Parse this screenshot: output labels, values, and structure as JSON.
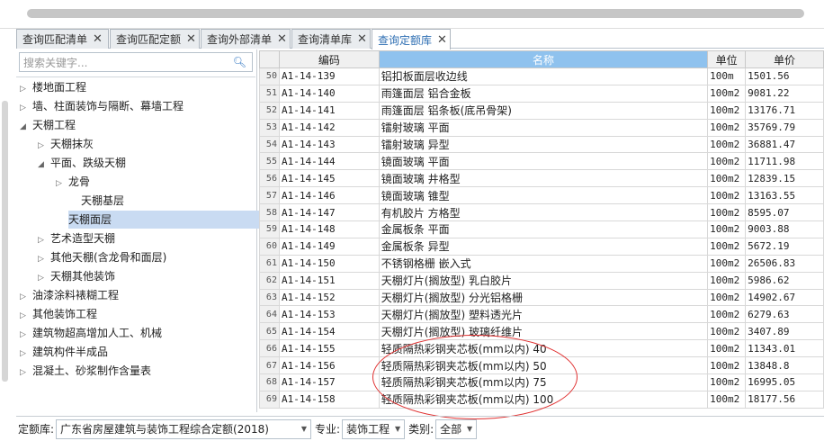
{
  "tabs": [
    {
      "label": "查询匹配清单",
      "close": "✕"
    },
    {
      "label": "查询匹配定额",
      "close": "✕"
    },
    {
      "label": "查询外部清单",
      "close": "✕"
    },
    {
      "label": "查询清单库",
      "close": "✕"
    },
    {
      "label": "查询定额库",
      "close": "✕"
    }
  ],
  "search": {
    "placeholder": "搜索关键字..."
  },
  "tree": [
    {
      "label": "楼地面工程",
      "arrow": "▷",
      "level": 0
    },
    {
      "label": "墙、柱面装饰与隔断、幕墙工程",
      "arrow": "▷",
      "level": 0
    },
    {
      "label": "天棚工程",
      "arrow": "◢",
      "level": 0
    },
    {
      "label": "天棚抹灰",
      "arrow": "▷",
      "level": 1
    },
    {
      "label": "平面、跌级天棚",
      "arrow": "◢",
      "level": 1
    },
    {
      "label": "龙骨",
      "arrow": "▷",
      "level": 2
    },
    {
      "label": "天棚基层",
      "arrow": "",
      "level": 2
    },
    {
      "label": "天棚面层",
      "arrow": "",
      "level": 2,
      "selected": true
    },
    {
      "label": "艺术造型天棚",
      "arrow": "▷",
      "level": 1
    },
    {
      "label": "其他天棚(含龙骨和面层)",
      "arrow": "▷",
      "level": 1
    },
    {
      "label": "天棚其他装饰",
      "arrow": "▷",
      "level": 1
    },
    {
      "label": "油漆涂料裱糊工程",
      "arrow": "▷",
      "level": 0
    },
    {
      "label": "其他装饰工程",
      "arrow": "▷",
      "level": 0
    },
    {
      "label": "建筑物超高增加人工、机械",
      "arrow": "▷",
      "level": 0
    },
    {
      "label": "建筑构件半成品",
      "arrow": "▷",
      "level": 0
    },
    {
      "label": "混凝土、砂浆制作含量表",
      "arrow": "▷",
      "level": 0
    }
  ],
  "columns": {
    "code": "编码",
    "name": "名称",
    "unit": "单位",
    "price": "单价"
  },
  "rows": [
    {
      "n": "50",
      "code": "A1-14-139",
      "name": "铝扣板面层收边线",
      "unit": "100m",
      "price": "1501.56"
    },
    {
      "n": "51",
      "code": "A1-14-140",
      "name": "雨篷面层 铝合金板",
      "unit": "100m2",
      "price": "9081.22"
    },
    {
      "n": "52",
      "code": "A1-14-141",
      "name": "雨篷面层 铝条板(底吊骨架)",
      "unit": "100m2",
      "price": "13176.71"
    },
    {
      "n": "53",
      "code": "A1-14-142",
      "name": "镭射玻璃 平面",
      "unit": "100m2",
      "price": "35769.79"
    },
    {
      "n": "54",
      "code": "A1-14-143",
      "name": "镭射玻璃 异型",
      "unit": "100m2",
      "price": "36881.47"
    },
    {
      "n": "55",
      "code": "A1-14-144",
      "name": "镜面玻璃 平面",
      "unit": "100m2",
      "price": "11711.98"
    },
    {
      "n": "56",
      "code": "A1-14-145",
      "name": "镜面玻璃 井格型",
      "unit": "100m2",
      "price": "12839.15"
    },
    {
      "n": "57",
      "code": "A1-14-146",
      "name": "镜面玻璃 锥型",
      "unit": "100m2",
      "price": "13163.55"
    },
    {
      "n": "58",
      "code": "A1-14-147",
      "name": "有机胶片 方格型",
      "unit": "100m2",
      "price": "8595.07"
    },
    {
      "n": "59",
      "code": "A1-14-148",
      "name": "金属板条 平面",
      "unit": "100m2",
      "price": "9003.88"
    },
    {
      "n": "60",
      "code": "A1-14-149",
      "name": "金属板条 异型",
      "unit": "100m2",
      "price": "5672.19"
    },
    {
      "n": "61",
      "code": "A1-14-150",
      "name": "不锈钢格栅 嵌入式",
      "unit": "100m2",
      "price": "26506.83"
    },
    {
      "n": "62",
      "code": "A1-14-151",
      "name": "天棚灯片(搁放型) 乳白胶片",
      "unit": "100m2",
      "price": "5986.62"
    },
    {
      "n": "63",
      "code": "A1-14-152",
      "name": "天棚灯片(搁放型) 分光铝格栅",
      "unit": "100m2",
      "price": "14902.67"
    },
    {
      "n": "64",
      "code": "A1-14-153",
      "name": "天棚灯片(搁放型) 塑料透光片",
      "unit": "100m2",
      "price": "6279.63"
    },
    {
      "n": "65",
      "code": "A1-14-154",
      "name": "天棚灯片(搁放型) 玻璃纤维片",
      "unit": "100m2",
      "price": "3407.89"
    },
    {
      "n": "66",
      "code": "A1-14-155",
      "name": "轻质隔热彩钢夹芯板(mm以内) 40",
      "unit": "100m2",
      "price": "11343.01"
    },
    {
      "n": "67",
      "code": "A1-14-156",
      "name": "轻质隔热彩钢夹芯板(mm以内) 50",
      "unit": "100m2",
      "price": "13848.8"
    },
    {
      "n": "68",
      "code": "A1-14-157",
      "name": "轻质隔热彩钢夹芯板(mm以内) 75",
      "unit": "100m2",
      "price": "16995.05"
    },
    {
      "n": "69",
      "code": "A1-14-158",
      "name": "轻质隔热彩钢夹芯板(mm以内) 100",
      "unit": "100m2",
      "price": "18177.56"
    }
  ],
  "bottom": {
    "quota_label": "定额库:",
    "quota_value": "广东省房屋建筑与装饰工程综合定额(2018)",
    "major_label": "专业:",
    "major_value": "装饰工程",
    "category_label": "类别:",
    "category_value": "全部"
  },
  "colors": {
    "accent": "#2f6fb3",
    "header_highlight": "#8fc2ee",
    "selection": "#c9dbf2",
    "annotation": "#e03030"
  }
}
